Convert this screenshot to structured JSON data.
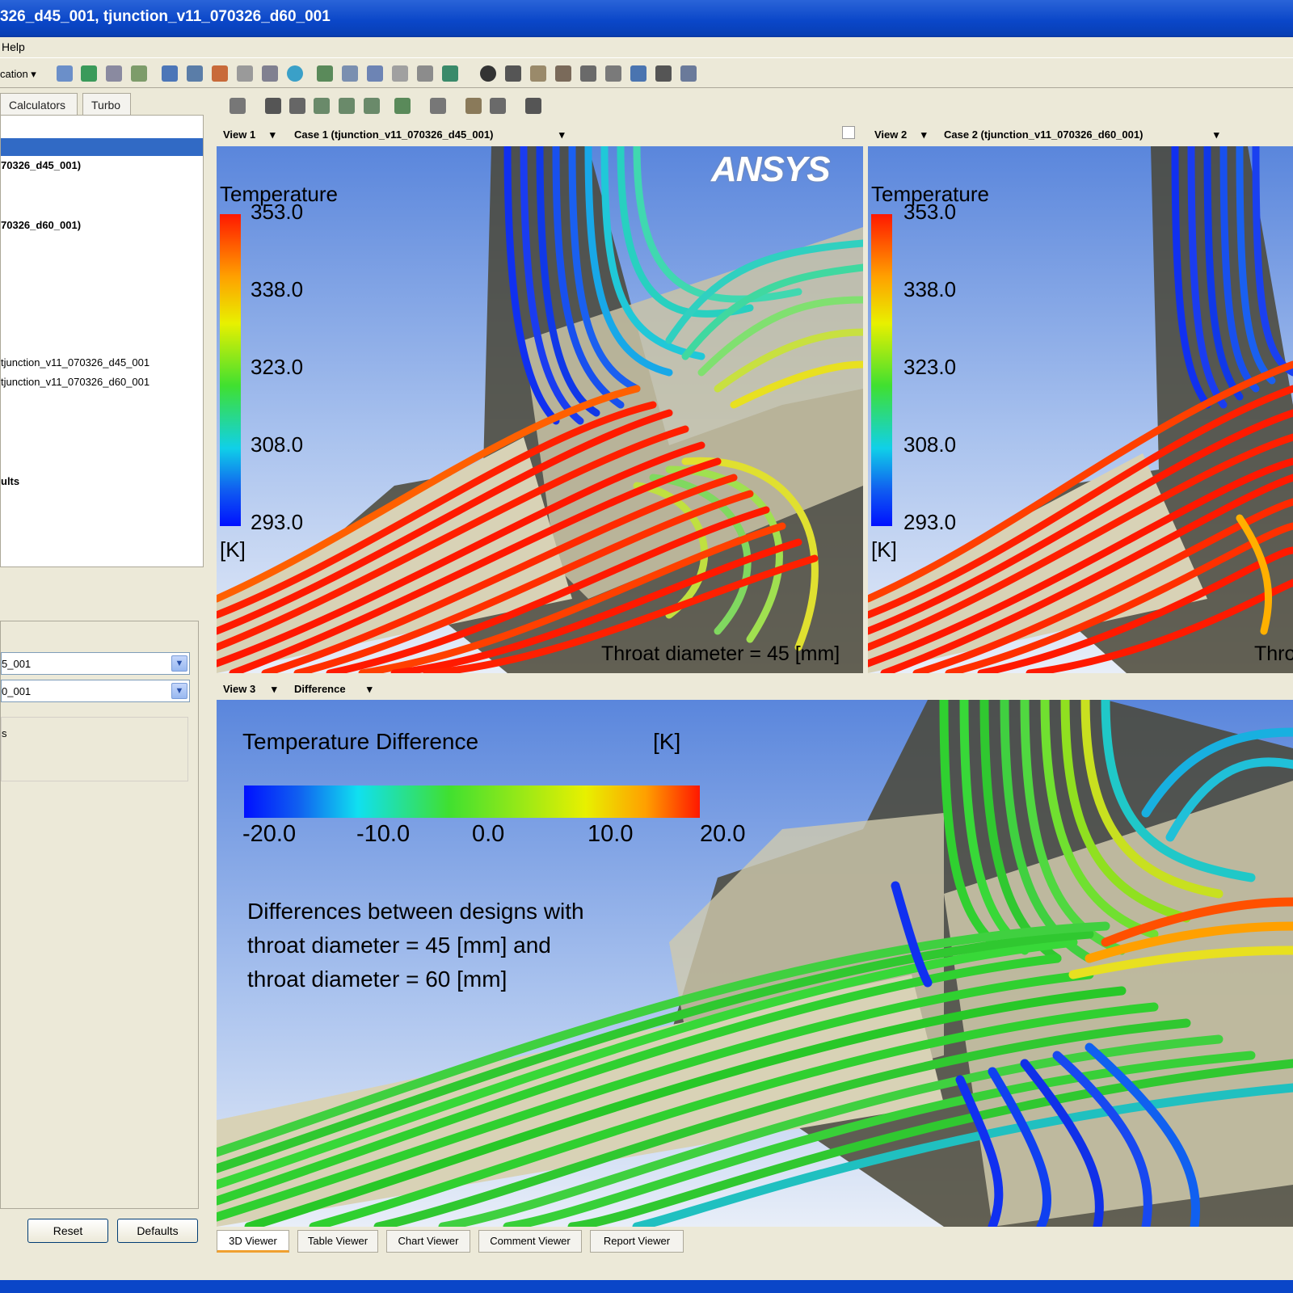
{
  "window": {
    "title": "326_d45_001, tjunction_v11_070326_d60_001"
  },
  "menu": {
    "help": "Help"
  },
  "toolbar": {
    "location_label": "cation ▾"
  },
  "left_tabs": {
    "calculators": "Calculators",
    "turbo": "Turbo"
  },
  "tree": {
    "case1": "70326_d45_001)",
    "case2": "70326_d60_001)",
    "file1": "tjunction_v11_070326_d45_001",
    "file2": "tjunction_v11_070326_d60_001",
    "results": "ults"
  },
  "details": {
    "combo1_value": "5_001",
    "combo2_value": "0_001",
    "stray": "s",
    "reset": "Reset",
    "defaults": "Defaults"
  },
  "view1": {
    "view_label": "View 1",
    "case_label": "Case 1 (tjunction_v11_070326_d45_001)",
    "logo": "ANSYS",
    "legend_title": "Temperature",
    "ticks": [
      "353.0",
      "338.0",
      "323.0",
      "308.0",
      "293.0"
    ],
    "unit": "[K]",
    "annotation": "Throat diameter = 45 [mm]"
  },
  "view2": {
    "view_label": "View 2",
    "case_label": "Case 2 (tjunction_v11_070326_d60_001)",
    "legend_title": "Temperature",
    "ticks": [
      "353.0",
      "338.0",
      "323.0",
      "308.0",
      "293.0"
    ],
    "unit": "[K]",
    "annotation": "Thro"
  },
  "view3": {
    "view_label": "View 3",
    "case_label": "Difference",
    "legend_title": "Temperature Difference",
    "unit": "[K]",
    "ticks": [
      "-20.0",
      "-10.0",
      "0.0",
      "10.0",
      "20.0"
    ],
    "annotation_lines": [
      "Differences between designs with",
      "throat diameter = 45 [mm] and",
      "throat diameter = 60 [mm]"
    ]
  },
  "bottom_tabs": [
    "3D Viewer",
    "Table Viewer",
    "Chart Viewer",
    "Comment Viewer",
    "Report Viewer"
  ],
  "colors": {
    "accent": "#0a46c8",
    "selection": "#316ac5",
    "hot": "#ff1a00",
    "cold": "#0014ff"
  }
}
